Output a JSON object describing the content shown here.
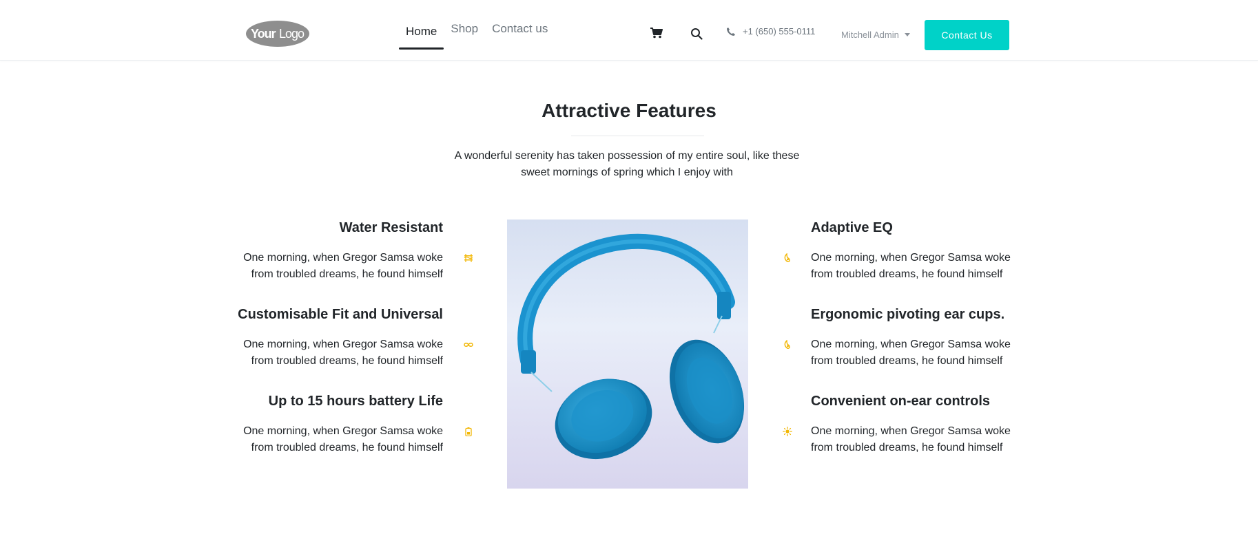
{
  "header": {
    "logo_text": "YourLogo",
    "nav": [
      {
        "label": "Home",
        "active": true
      },
      {
        "label": "Shop",
        "active": false
      },
      {
        "label": "Contact us",
        "active": false
      }
    ],
    "phone": "+1 (650) 555-0111",
    "user": "Mitchell Admin",
    "cta_label": "Contact Us"
  },
  "section": {
    "title": "Attractive Features",
    "subtitle": "A wonderful serenity has taken possession of my entire soul, like these sweet mornings of spring which I enjoy with"
  },
  "features_left": [
    {
      "title": "Water Resistant",
      "text": "One morning, when Gregor Samsa woke from troubled dreams, he found himself",
      "icon": "water-icon"
    },
    {
      "title": "Customisable Fit and Universal",
      "text": "One morning, when Gregor Samsa woke from troubled dreams, he found himself",
      "icon": "infinity-icon"
    },
    {
      "title": "Up to 15 hours battery Life",
      "text": "One morning, when Gregor Samsa woke from troubled dreams, he found himself",
      "icon": "battery-icon"
    }
  ],
  "features_right": [
    {
      "title": "Adaptive EQ",
      "text": "One morning, when Gregor Samsa woke from troubled dreams, he found himself",
      "icon": "eq-icon"
    },
    {
      "title": "Ergonomic pivoting ear cups.",
      "text": "One morning, when Gregor Samsa woke from troubled dreams, he found himself",
      "icon": "ear-cup-icon"
    },
    {
      "title": "Convenient on-ear controls",
      "text": "One morning, when Gregor Samsa woke from troubled dreams, he found himself",
      "icon": "controls-icon"
    }
  ],
  "colors": {
    "accent": "#00d2c8",
    "icon": "#f2b705",
    "text": "#212529",
    "muted": "#6c757d"
  }
}
